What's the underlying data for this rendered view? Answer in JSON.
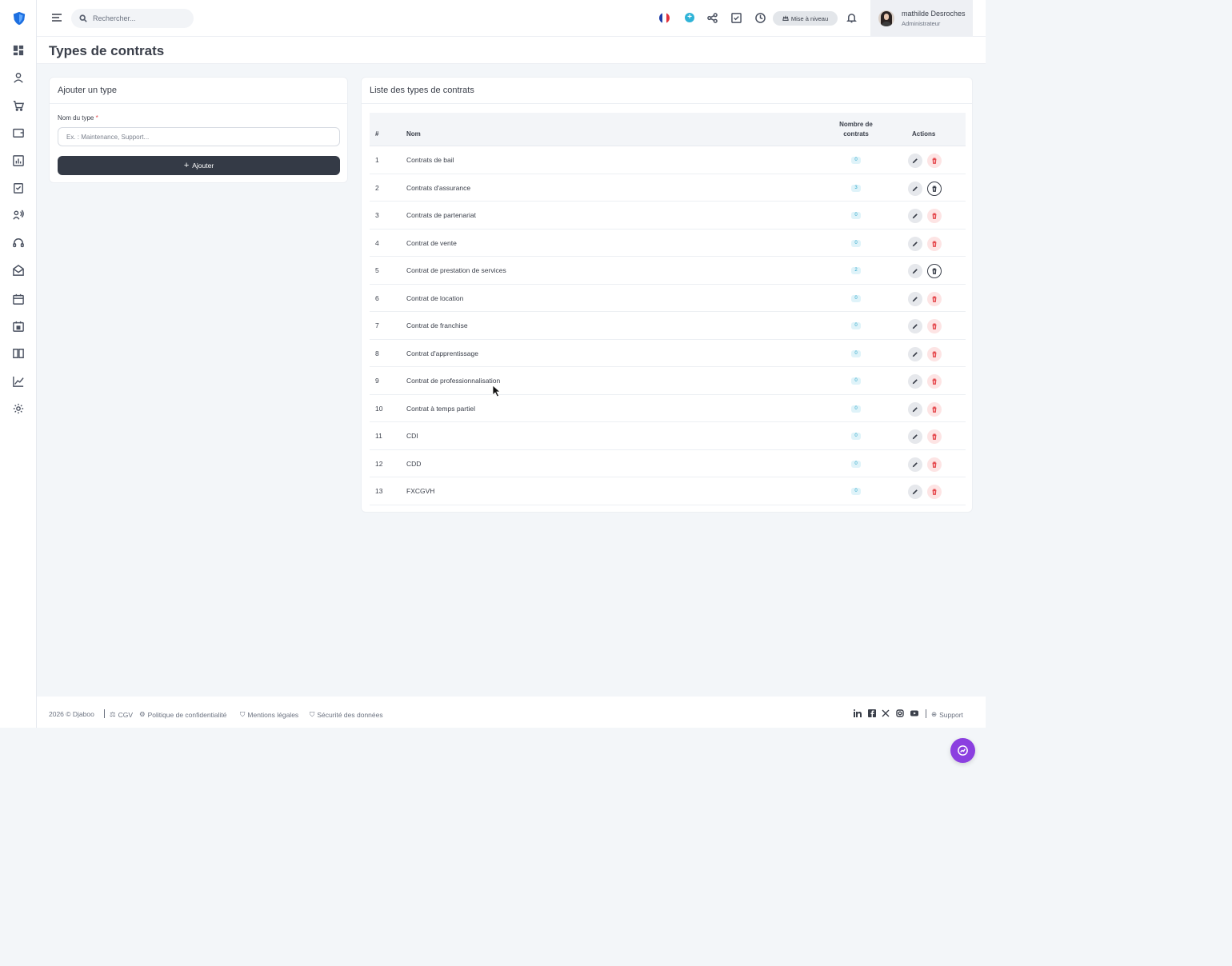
{
  "header": {
    "search_placeholder": "Rechercher...",
    "upgrade_label": "Mise à niveau",
    "user_name": "mathilde Desroches",
    "user_role": "Administrateur"
  },
  "page": {
    "title": "Types de contrats"
  },
  "add_form": {
    "title": "Ajouter un type",
    "field_label": "Nom du type",
    "required_mark": "*",
    "placeholder": "Ex. : Maintenance, Support...",
    "button_label": "Ajouter"
  },
  "list": {
    "title": "Liste des types de contrats",
    "columns": {
      "index": "#",
      "name": "Nom",
      "count_line1": "Nombre de",
      "count_line2": "contrats",
      "actions": "Actions"
    },
    "rows": [
      {
        "index": "1",
        "name": "Contrats de bail",
        "count": "0"
      },
      {
        "index": "2",
        "name": "Contrats d'assurance",
        "count": "3"
      },
      {
        "index": "3",
        "name": "Contrats de partenariat",
        "count": "0"
      },
      {
        "index": "4",
        "name": "Contrat de vente",
        "count": "0"
      },
      {
        "index": "5",
        "name": "Contrat de prestation de services",
        "count": "2"
      },
      {
        "index": "6",
        "name": "Contrat de location",
        "count": "0"
      },
      {
        "index": "7",
        "name": "Contrat de franchise",
        "count": "0"
      },
      {
        "index": "8",
        "name": "Contrat d'apprentissage",
        "count": "0"
      },
      {
        "index": "9",
        "name": "Contrat de professionnalisation",
        "count": "0"
      },
      {
        "index": "10",
        "name": "Contrat à temps partiel",
        "count": "0"
      },
      {
        "index": "11",
        "name": "CDI",
        "count": "0"
      },
      {
        "index": "12",
        "name": "CDD",
        "count": "0"
      },
      {
        "index": "13",
        "name": "FXCGVH",
        "count": "0"
      }
    ]
  },
  "footer": {
    "copyright": "2026 © Djaboo",
    "cgv": "CGV",
    "privacy": "Politique de confidentialité",
    "legal": "Mentions légales",
    "security": "Sécurité des données",
    "support": "Support"
  },
  "colors": {
    "accent_dark": "#343a46",
    "badge_text": "#2aa5c9",
    "delete_red": "#e5484d",
    "chat_purple": "#8b3fe0"
  }
}
